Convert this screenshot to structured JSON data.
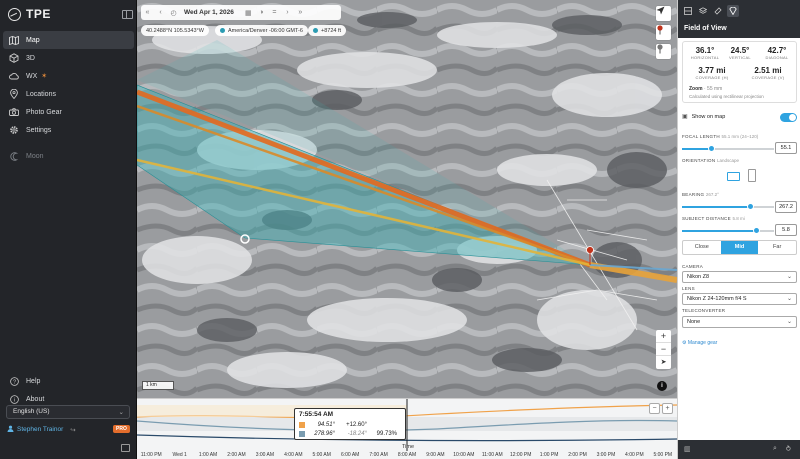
{
  "sidebar": {
    "app_name": "TPE",
    "nav": [
      {
        "label": "Map",
        "icon": "map-icon",
        "active": true
      },
      {
        "label": "3D",
        "icon": "cube-icon"
      },
      {
        "label": "WX",
        "icon": "cloud-icon",
        "badge": "flame"
      },
      {
        "label": "Locations",
        "icon": "location-pin-icon"
      },
      {
        "label": "Photo Gear",
        "icon": "camera-icon"
      },
      {
        "label": "Settings",
        "icon": "gear-icon"
      }
    ],
    "moon_label": "Moon",
    "help_label": "Help",
    "about_label": "About",
    "language": "English (US)",
    "user_name": "Stephen Trainor",
    "pro_badge": "PRO"
  },
  "map": {
    "date": "Wed Apr 1, 2026",
    "coordinates": "40.2488°N 105.5343°W",
    "timezone": "America/Denver -06:00 GMT-6",
    "elevation": "+8724 ft",
    "scale_label": "1 km"
  },
  "timeline": {
    "tooltip_time": "7:55:54 AM",
    "sun_azimuth": "94.51°",
    "sun_altitude": "+12.60°",
    "moon_azimuth": "278.96°",
    "moon_altitude": "-18.24°",
    "moon_illumination": "99.73%",
    "axis_label": "Time",
    "ticks": [
      "11:00 PM",
      "Wed 1",
      "1:00 AM",
      "2:00 AM",
      "3:00 AM",
      "4:00 AM",
      "5:00 AM",
      "6:00 AM",
      "7:00 AM",
      "8:00 AM",
      "9:00 AM",
      "10:00 AM",
      "11:00 AM",
      "12:00 PM",
      "1:00 PM",
      "2:00 PM",
      "3:00 PM",
      "4:00 PM",
      "5:00 PM"
    ],
    "colors": {
      "sun": "#f0a24a",
      "moon": "#7a9cb0"
    }
  },
  "panel": {
    "title": "Field of View",
    "horizontal_value": "36.1°",
    "horizontal_label": "HORIZONTAL",
    "vertical_value": "24.5°",
    "vertical_label": "VERTICAL",
    "diagonal_value": "42.7°",
    "diagonal_label": "DIAGONAL",
    "coverage_h_value": "3.77 mi",
    "coverage_h_label": "COVERAGE (H)",
    "coverage_v_value": "2.51 mi",
    "coverage_v_label": "COVERAGE (V)",
    "zoom_label": "Zoom",
    "zoom_value": "· 55 mm",
    "calc_note": "Calculated using rectilinear projection",
    "show_on_map": "Show on map",
    "show_on_map_on": true,
    "focal_label": "FOCAL LENGTH",
    "focal_hint": "55.1 mm (24–120)",
    "focal_value": "55.1",
    "focal_level": 0.32,
    "orientation_label": "ORIENTATION",
    "orientation_hint": "Landscape",
    "bearing_label": "BEARING",
    "bearing_hint": "267.2°",
    "bearing_value": "267.2",
    "bearing_level": 0.74,
    "distance_label": "SUBJECT DISTANCE",
    "distance_hint": "5.8 mi",
    "distance_value": "5.8",
    "distance_level": 0.8,
    "range_options": [
      "Close",
      "Mid",
      "Far"
    ],
    "range_selected": "Mid",
    "camera_label": "CAMERA",
    "camera_value": "Nikon Z8",
    "lens_label": "LENS",
    "lens_value": "Nikon Z 24-120mm f/4 S",
    "tele_label": "TELECONVERTER",
    "tele_value": "None",
    "manage_gear": "Manage gear",
    "accent": "#2fa3e0"
  }
}
